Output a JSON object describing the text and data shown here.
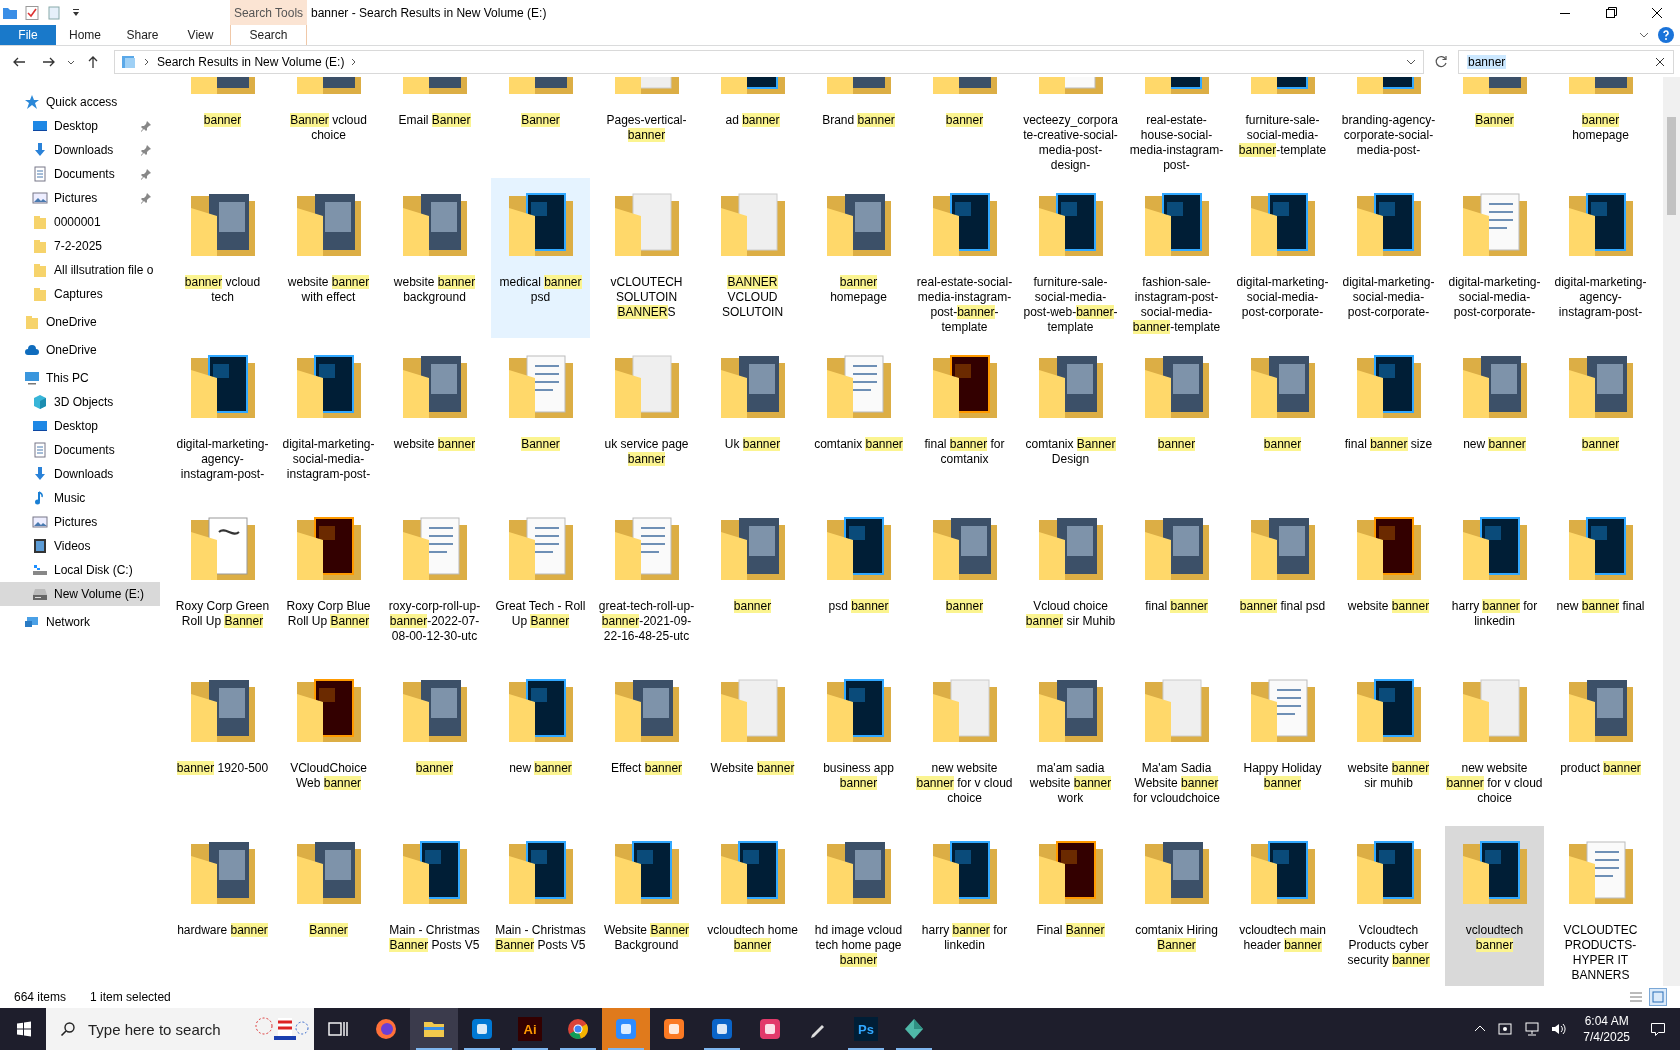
{
  "window": {
    "title": "banner - Search Results in New Volume (E:)",
    "context_group": "Search Tools"
  },
  "ribbon": {
    "file_tab": "File",
    "tabs": [
      {
        "label": "Home",
        "selected": false
      },
      {
        "label": "Share",
        "selected": false
      },
      {
        "label": "View",
        "selected": false
      },
      {
        "label": "Search",
        "selected": true
      }
    ]
  },
  "address": {
    "path": "Search Results in New Volume (E:)",
    "search_value": "banner"
  },
  "sidebar": {
    "items": [
      {
        "label": "Quick access",
        "kind": "star",
        "selected": false,
        "children": [
          {
            "label": "Desktop",
            "kind": "desktop",
            "pinned": true,
            "selected": false
          },
          {
            "label": "Downloads",
            "kind": "download",
            "pinned": true,
            "selected": false
          },
          {
            "label": "Documents",
            "kind": "document",
            "pinned": true,
            "selected": false
          },
          {
            "label": "Pictures",
            "kind": "picture",
            "pinned": true,
            "selected": false
          },
          {
            "label": "0000001",
            "kind": "folder",
            "pinned": false,
            "selected": false
          },
          {
            "label": "7-2-2025",
            "kind": "folder",
            "pinned": false,
            "selected": false
          },
          {
            "label": "All illsutration file o",
            "kind": "folder",
            "pinned": false,
            "selected": false
          },
          {
            "label": "Captures",
            "kind": "folder",
            "pinned": false,
            "selected": false
          }
        ]
      },
      {
        "label": "OneDrive",
        "kind": "folder",
        "selected": false
      },
      {
        "label": "OneDrive",
        "kind": "cloud",
        "selected": false
      },
      {
        "label": "This PC",
        "kind": "pc",
        "selected": false,
        "children": [
          {
            "label": "3D Objects",
            "kind": "cube",
            "pinned": false,
            "selected": false
          },
          {
            "label": "Desktop",
            "kind": "desktop",
            "pinned": false,
            "selected": false
          },
          {
            "label": "Documents",
            "kind": "document",
            "pinned": false,
            "selected": false
          },
          {
            "label": "Downloads",
            "kind": "download",
            "pinned": false,
            "selected": false
          },
          {
            "label": "Music",
            "kind": "music",
            "pinned": false,
            "selected": false
          },
          {
            "label": "Pictures",
            "kind": "picture",
            "pinned": false,
            "selected": false
          },
          {
            "label": "Videos",
            "kind": "video",
            "pinned": false,
            "selected": false
          },
          {
            "label": "Local Disk (C:)",
            "kind": "disk",
            "pinned": false,
            "selected": false
          },
          {
            "label": "New Volume (E:)",
            "kind": "drive",
            "pinned": false,
            "selected": true
          }
        ]
      },
      {
        "label": "Network",
        "kind": "network",
        "selected": false
      }
    ]
  },
  "results": {
    "items": [
      {
        "kind": "image",
        "selected": false,
        "hovered": false,
        "label": [
          {
            "text": "banner",
            "match": true
          }
        ]
      },
      {
        "kind": "image",
        "selected": false,
        "hovered": false,
        "label": [
          {
            "text": "Banner",
            "match": true
          },
          {
            "text": " vcloud choice",
            "match": false
          }
        ]
      },
      {
        "kind": "image",
        "selected": false,
        "hovered": false,
        "label": [
          {
            "text": "Email ",
            "match": false
          },
          {
            "text": "Banner",
            "match": true
          }
        ]
      },
      {
        "kind": "image",
        "selected": false,
        "hovered": false,
        "label": [
          {
            "text": "Banner",
            "match": true
          }
        ]
      },
      {
        "kind": "plain",
        "selected": false,
        "hovered": false,
        "label": [
          {
            "text": "Pages-vertical-",
            "match": false
          },
          {
            "text": "banner",
            "match": true
          }
        ]
      },
      {
        "kind": "psd",
        "selected": false,
        "hovered": false,
        "label": [
          {
            "text": "ad ",
            "match": false
          },
          {
            "text": "banner",
            "match": true
          }
        ]
      },
      {
        "kind": "image",
        "selected": false,
        "hovered": false,
        "label": [
          {
            "text": "Brand ",
            "match": false
          },
          {
            "text": "banner",
            "match": true
          }
        ]
      },
      {
        "kind": "image",
        "selected": false,
        "hovered": false,
        "label": [
          {
            "text": "banner",
            "match": true
          }
        ]
      },
      {
        "kind": "doc",
        "selected": false,
        "hovered": false,
        "label": [
          {
            "text": "vecteezy_corporate-creative-social-media-post-design-",
            "match": false
          }
        ]
      },
      {
        "kind": "psd",
        "selected": false,
        "hovered": false,
        "label": [
          {
            "text": "real-estate-house-social-media-instagram-post-",
            "match": false
          }
        ]
      },
      {
        "kind": "psd",
        "selected": false,
        "hovered": false,
        "label": [
          {
            "text": "furniture-sale-social-media-",
            "match": false
          },
          {
            "text": "banner",
            "match": true
          },
          {
            "text": "-template",
            "match": false
          }
        ]
      },
      {
        "kind": "psd",
        "selected": false,
        "hovered": false,
        "label": [
          {
            "text": "branding-agency-corporate-social-media-post-",
            "match": false
          }
        ]
      },
      {
        "kind": "image",
        "selected": false,
        "hovered": false,
        "label": [
          {
            "text": "Banner",
            "match": true
          }
        ]
      },
      {
        "kind": "image",
        "selected": false,
        "hovered": false,
        "label": [
          {
            "text": "banner",
            "match": true
          },
          {
            "text": " homepage",
            "match": false
          }
        ]
      },
      {
        "kind": "image",
        "selected": false,
        "hovered": false,
        "label": [
          {
            "text": "banner",
            "match": true
          },
          {
            "text": " vcloud tech",
            "match": false
          }
        ]
      },
      {
        "kind": "image",
        "selected": false,
        "hovered": false,
        "label": [
          {
            "text": "website ",
            "match": false
          },
          {
            "text": "banner",
            "match": true
          },
          {
            "text": " with effect",
            "match": false
          }
        ]
      },
      {
        "kind": "image",
        "selected": false,
        "hovered": false,
        "label": [
          {
            "text": "website ",
            "match": false
          },
          {
            "text": "banner",
            "match": true
          },
          {
            "text": " background",
            "match": false
          }
        ]
      },
      {
        "kind": "psd",
        "selected": false,
        "hovered": true,
        "label": [
          {
            "text": "medical ",
            "match": false
          },
          {
            "text": "banner",
            "match": true
          },
          {
            "text": " psd",
            "match": false
          }
        ]
      },
      {
        "kind": "plain",
        "selected": false,
        "hovered": false,
        "label": [
          {
            "text": "vCLOUTECH SOLUTOIN ",
            "match": false
          },
          {
            "text": "BANNER",
            "match": true
          },
          {
            "text": "S",
            "match": false
          }
        ]
      },
      {
        "kind": "plain",
        "selected": false,
        "hovered": false,
        "label": [
          {
            "text": "BANNER",
            "match": true
          },
          {
            "text": " VCLOUD SOLUTOIN",
            "match": false
          }
        ]
      },
      {
        "kind": "image",
        "selected": false,
        "hovered": false,
        "label": [
          {
            "text": "banner",
            "match": true
          },
          {
            "text": " homepage",
            "match": false
          }
        ]
      },
      {
        "kind": "psd",
        "selected": false,
        "hovered": false,
        "label": [
          {
            "text": "real-estate-social-media-instagram-post-",
            "match": false
          },
          {
            "text": "banner",
            "match": true
          },
          {
            "text": "-template",
            "match": false
          }
        ]
      },
      {
        "kind": "psd",
        "selected": false,
        "hovered": false,
        "label": [
          {
            "text": "furniture-sale-social-media-post-web-",
            "match": false
          },
          {
            "text": "banner",
            "match": true
          },
          {
            "text": "-template",
            "match": false
          }
        ]
      },
      {
        "kind": "psd",
        "selected": false,
        "hovered": false,
        "label": [
          {
            "text": "fashion-sale-instagram-post-social-media-",
            "match": false
          },
          {
            "text": "banner",
            "match": true
          },
          {
            "text": "-template",
            "match": false
          }
        ]
      },
      {
        "kind": "psd",
        "selected": false,
        "hovered": false,
        "label": [
          {
            "text": "digital-marketing-social-media-post-corporate-",
            "match": false
          }
        ]
      },
      {
        "kind": "psd",
        "selected": false,
        "hovered": false,
        "label": [
          {
            "text": "digital-marketing-social-media-post-corporate-",
            "match": false
          }
        ]
      },
      {
        "kind": "doc",
        "selected": false,
        "hovered": false,
        "label": [
          {
            "text": "digital-marketing-social-media-post-corporate-",
            "match": false
          }
        ]
      },
      {
        "kind": "psd",
        "selected": false,
        "hovered": false,
        "label": [
          {
            "text": "digital-marketing-agency-instagram-post-",
            "match": false
          }
        ]
      },
      {
        "kind": "psd",
        "selected": false,
        "hovered": false,
        "label": [
          {
            "text": "digital-marketing-agency-instagram-post-",
            "match": false
          }
        ]
      },
      {
        "kind": "psd",
        "selected": false,
        "hovered": false,
        "label": [
          {
            "text": "digital-marketing-social-media-instagram-post-",
            "match": false
          }
        ]
      },
      {
        "kind": "image",
        "selected": false,
        "hovered": false,
        "label": [
          {
            "text": "website ",
            "match": false
          },
          {
            "text": "banner",
            "match": true
          }
        ]
      },
      {
        "kind": "doc",
        "selected": false,
        "hovered": false,
        "label": [
          {
            "text": "Banner",
            "match": true
          }
        ]
      },
      {
        "kind": "plain",
        "selected": false,
        "hovered": false,
        "label": [
          {
            "text": "uk service page ",
            "match": false
          },
          {
            "text": "banner",
            "match": true
          }
        ]
      },
      {
        "kind": "image",
        "selected": false,
        "hovered": false,
        "label": [
          {
            "text": "Uk ",
            "match": false
          },
          {
            "text": "banner",
            "match": true
          }
        ]
      },
      {
        "kind": "doc",
        "selected": false,
        "hovered": false,
        "label": [
          {
            "text": "comtanix ",
            "match": false
          },
          {
            "text": "banner",
            "match": true
          }
        ]
      },
      {
        "kind": "ai",
        "selected": false,
        "hovered": false,
        "label": [
          {
            "text": "final ",
            "match": false
          },
          {
            "text": "banner",
            "match": true
          },
          {
            "text": " for comtanix",
            "match": false
          }
        ]
      },
      {
        "kind": "image",
        "selected": false,
        "hovered": false,
        "label": [
          {
            "text": "comtanix ",
            "match": false
          },
          {
            "text": "Banner",
            "match": true
          },
          {
            "text": " Design",
            "match": false
          }
        ]
      },
      {
        "kind": "image",
        "selected": false,
        "hovered": false,
        "label": [
          {
            "text": "banner",
            "match": true
          }
        ]
      },
      {
        "kind": "image",
        "selected": false,
        "hovered": false,
        "label": [
          {
            "text": "banner",
            "match": true
          }
        ]
      },
      {
        "kind": "psd",
        "selected": false,
        "hovered": false,
        "label": [
          {
            "text": "final ",
            "match": false
          },
          {
            "text": "banner",
            "match": true
          },
          {
            "text": " size",
            "match": false
          }
        ]
      },
      {
        "kind": "image",
        "selected": false,
        "hovered": false,
        "label": [
          {
            "text": "new ",
            "match": false
          },
          {
            "text": "banner",
            "match": true
          }
        ]
      },
      {
        "kind": "image",
        "selected": false,
        "hovered": false,
        "label": [
          {
            "text": "banner",
            "match": true
          }
        ]
      },
      {
        "kind": "eps",
        "selected": false,
        "hovered": false,
        "label": [
          {
            "text": "Roxy Corp Green Roll Up ",
            "match": false
          },
          {
            "text": "Banner",
            "match": true
          }
        ]
      },
      {
        "kind": "ai",
        "selected": false,
        "hovered": false,
        "label": [
          {
            "text": "Roxy Corp Blue Roll Up ",
            "match": false
          },
          {
            "text": "Banner",
            "match": true
          }
        ]
      },
      {
        "kind": "doc",
        "selected": false,
        "hovered": false,
        "label": [
          {
            "text": "roxy-corp-roll-up-",
            "match": false
          },
          {
            "text": "banner",
            "match": true
          },
          {
            "text": "-2022-07-08-00-12-30-utc",
            "match": false
          }
        ]
      },
      {
        "kind": "doc",
        "selected": false,
        "hovered": false,
        "label": [
          {
            "text": "Great Tech - Roll Up ",
            "match": false
          },
          {
            "text": "Banner",
            "match": true
          }
        ]
      },
      {
        "kind": "doc",
        "selected": false,
        "hovered": false,
        "label": [
          {
            "text": "great-tech-roll-up-",
            "match": false
          },
          {
            "text": "banner",
            "match": true
          },
          {
            "text": "-2021-09-22-16-48-25-utc",
            "match": false
          }
        ]
      },
      {
        "kind": "image",
        "selected": false,
        "hovered": false,
        "label": [
          {
            "text": "banner",
            "match": true
          }
        ]
      },
      {
        "kind": "psd",
        "selected": false,
        "hovered": false,
        "label": [
          {
            "text": "psd ",
            "match": false
          },
          {
            "text": "banner",
            "match": true
          }
        ]
      },
      {
        "kind": "image",
        "selected": false,
        "hovered": false,
        "label": [
          {
            "text": "banner",
            "match": true
          }
        ]
      },
      {
        "kind": "image",
        "selected": false,
        "hovered": false,
        "label": [
          {
            "text": "Vcloud choice ",
            "match": false
          },
          {
            "text": "banner",
            "match": true
          },
          {
            "text": " sir Muhib",
            "match": false
          }
        ]
      },
      {
        "kind": "image",
        "selected": false,
        "hovered": false,
        "label": [
          {
            "text": "final ",
            "match": false
          },
          {
            "text": "banner",
            "match": true
          }
        ]
      },
      {
        "kind": "image",
        "selected": false,
        "hovered": false,
        "label": [
          {
            "text": "banner",
            "match": true
          },
          {
            "text": " final psd",
            "match": false
          }
        ]
      },
      {
        "kind": "ai",
        "selected": false,
        "hovered": false,
        "label": [
          {
            "text": "website ",
            "match": false
          },
          {
            "text": "banner",
            "match": true
          }
        ]
      },
      {
        "kind": "psd",
        "selected": false,
        "hovered": false,
        "label": [
          {
            "text": "harry ",
            "match": false
          },
          {
            "text": "banner",
            "match": true
          },
          {
            "text": " for linkedin",
            "match": false
          }
        ]
      },
      {
        "kind": "psd",
        "selected": false,
        "hovered": false,
        "label": [
          {
            "text": "new ",
            "match": false
          },
          {
            "text": "banner",
            "match": true
          },
          {
            "text": " final",
            "match": false
          }
        ]
      },
      {
        "kind": "image",
        "selected": false,
        "hovered": false,
        "label": [
          {
            "text": "banner",
            "match": true
          },
          {
            "text": " 1920-500",
            "match": false
          }
        ]
      },
      {
        "kind": "ai",
        "selected": false,
        "hovered": false,
        "label": [
          {
            "text": "VCloudChoice Web ",
            "match": false
          },
          {
            "text": "banner",
            "match": true
          }
        ]
      },
      {
        "kind": "image",
        "selected": false,
        "hovered": false,
        "label": [
          {
            "text": "banner",
            "match": true
          }
        ]
      },
      {
        "kind": "psd",
        "selected": false,
        "hovered": false,
        "label": [
          {
            "text": "new ",
            "match": false
          },
          {
            "text": "banner",
            "match": true
          }
        ]
      },
      {
        "kind": "image",
        "selected": false,
        "hovered": false,
        "label": [
          {
            "text": "Effect ",
            "match": false
          },
          {
            "text": "banner",
            "match": true
          }
        ]
      },
      {
        "kind": "plain",
        "selected": false,
        "hovered": false,
        "label": [
          {
            "text": "Website ",
            "match": false
          },
          {
            "text": "banner",
            "match": true
          }
        ]
      },
      {
        "kind": "psd",
        "selected": false,
        "hovered": false,
        "label": [
          {
            "text": "business app ",
            "match": false
          },
          {
            "text": "banner",
            "match": true
          }
        ]
      },
      {
        "kind": "plain",
        "selected": false,
        "hovered": false,
        "label": [
          {
            "text": "new website ",
            "match": false
          },
          {
            "text": "banner",
            "match": true
          },
          {
            "text": " for v cloud choice",
            "match": false
          }
        ]
      },
      {
        "kind": "image",
        "selected": false,
        "hovered": false,
        "label": [
          {
            "text": "ma'am sadia website ",
            "match": false
          },
          {
            "text": "banner",
            "match": true
          },
          {
            "text": " work",
            "match": false
          }
        ]
      },
      {
        "kind": "plain",
        "selected": false,
        "hovered": false,
        "label": [
          {
            "text": "Ma'am  Sadia Website ",
            "match": false
          },
          {
            "text": "banner",
            "match": true
          },
          {
            "text": " for vcloudchoice",
            "match": false
          }
        ]
      },
      {
        "kind": "doc",
        "selected": false,
        "hovered": false,
        "label": [
          {
            "text": "Happy Holiday ",
            "match": false
          },
          {
            "text": "banner",
            "match": true
          }
        ]
      },
      {
        "kind": "psd",
        "selected": false,
        "hovered": false,
        "label": [
          {
            "text": "website ",
            "match": false
          },
          {
            "text": "banner",
            "match": true
          },
          {
            "text": " sir muhib",
            "match": false
          }
        ]
      },
      {
        "kind": "plain",
        "selected": false,
        "hovered": false,
        "label": [
          {
            "text": "new website ",
            "match": false
          },
          {
            "text": "banner",
            "match": true
          },
          {
            "text": " for v cloud choice",
            "match": false
          }
        ]
      },
      {
        "kind": "image",
        "selected": false,
        "hovered": false,
        "label": [
          {
            "text": "product ",
            "match": false
          },
          {
            "text": "banner",
            "match": true
          }
        ]
      },
      {
        "kind": "image",
        "selected": false,
        "hovered": false,
        "label": [
          {
            "text": "hardware ",
            "match": false
          },
          {
            "text": "banner",
            "match": true
          }
        ]
      },
      {
        "kind": "image",
        "selected": false,
        "hovered": false,
        "label": [
          {
            "text": "Banner",
            "match": true
          }
        ]
      },
      {
        "kind": "psd",
        "selected": false,
        "hovered": false,
        "label": [
          {
            "text": "Main - Christmas ",
            "match": false
          },
          {
            "text": "Banner",
            "match": true
          },
          {
            "text": " Posts V5",
            "match": false
          }
        ]
      },
      {
        "kind": "psd",
        "selected": false,
        "hovered": false,
        "label": [
          {
            "text": "Main - Christmas ",
            "match": false
          },
          {
            "text": "Banner",
            "match": true
          },
          {
            "text": " Posts V5",
            "match": false
          }
        ]
      },
      {
        "kind": "psd",
        "selected": false,
        "hovered": false,
        "label": [
          {
            "text": "Website ",
            "match": false
          },
          {
            "text": "Banner",
            "match": true
          },
          {
            "text": " Background",
            "match": false
          }
        ]
      },
      {
        "kind": "psd",
        "selected": false,
        "hovered": false,
        "label": [
          {
            "text": "vcloudtech home ",
            "match": false
          },
          {
            "text": "banner",
            "match": true
          }
        ]
      },
      {
        "kind": "image",
        "selected": false,
        "hovered": false,
        "label": [
          {
            "text": "hd image vcloud tech home page ",
            "match": false
          },
          {
            "text": "banner",
            "match": true
          }
        ]
      },
      {
        "kind": "psd",
        "selected": false,
        "hovered": false,
        "label": [
          {
            "text": "harry ",
            "match": false
          },
          {
            "text": "banner",
            "match": true
          },
          {
            "text": " for linkedin",
            "match": false
          }
        ]
      },
      {
        "kind": "ai",
        "selected": false,
        "hovered": false,
        "label": [
          {
            "text": "Final ",
            "match": false
          },
          {
            "text": "Banner",
            "match": true
          }
        ]
      },
      {
        "kind": "image",
        "selected": false,
        "hovered": false,
        "label": [
          {
            "text": "comtanix Hiring ",
            "match": false
          },
          {
            "text": "Banner",
            "match": true
          }
        ]
      },
      {
        "kind": "psd",
        "selected": false,
        "hovered": false,
        "label": [
          {
            "text": "vcloudtech main header ",
            "match": false
          },
          {
            "text": "banner",
            "match": true
          }
        ]
      },
      {
        "kind": "psd",
        "selected": false,
        "hovered": false,
        "label": [
          {
            "text": "Vcloudtech Products cyber security ",
            "match": false
          },
          {
            "text": "banner",
            "match": true
          }
        ]
      },
      {
        "kind": "psd",
        "selected": true,
        "hovered": false,
        "label": [
          {
            "text": "vcloudtech ",
            "match": false
          },
          {
            "text": "banner",
            "match": true
          }
        ]
      },
      {
        "kind": "doc",
        "selected": false,
        "hovered": false,
        "label": [
          {
            "text": "VCLOUDTEC PRODUCTS-HYPER IT BANNERS",
            "match": false
          }
        ]
      }
    ]
  },
  "status_bar": {
    "item_count": "664 items",
    "selection": "1 item selected"
  },
  "taskbar": {
    "search_placeholder": "Type here to search",
    "apps": [
      {
        "kind": "task-view",
        "running": false,
        "active": false
      },
      {
        "kind": "firefox",
        "running": false,
        "active": false
      },
      {
        "kind": "explorer",
        "running": true,
        "active": true
      },
      {
        "kind": "vscode",
        "running": true,
        "active": false
      },
      {
        "kind": "illustrator",
        "label": "Ai",
        "running": true,
        "active": false
      },
      {
        "kind": "chrome",
        "running": true,
        "active": false
      },
      {
        "kind": "zoom",
        "running": true,
        "active": true
      },
      {
        "kind": "xampp",
        "running": false,
        "active": false
      },
      {
        "kind": "outlook",
        "running": true,
        "active": false
      },
      {
        "kind": "creative-cloud",
        "running": false,
        "active": false
      },
      {
        "kind": "pen",
        "running": false,
        "active": false
      },
      {
        "kind": "photoshop",
        "label": "Ps",
        "running": true,
        "active": false
      },
      {
        "kind": "gem",
        "running": true,
        "active": false
      }
    ],
    "time": "6:04 AM",
    "date": "7/4/2025"
  }
}
